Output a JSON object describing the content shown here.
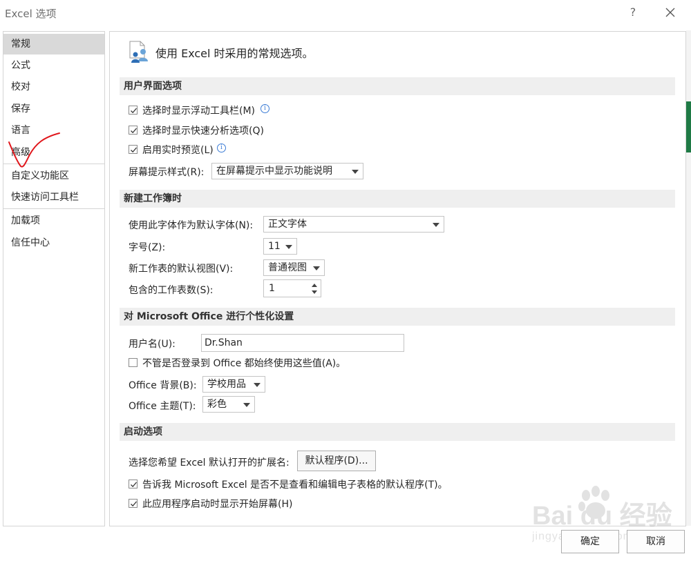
{
  "window": {
    "title": "Excel 选项",
    "help_label": "?"
  },
  "sidebar": {
    "items": [
      {
        "label": "常规",
        "active": true
      },
      {
        "label": "公式"
      },
      {
        "label": "校对"
      },
      {
        "label": "保存"
      },
      {
        "label": "语言"
      },
      {
        "label": "高级"
      },
      {
        "label": "自定义功能区"
      },
      {
        "label": "快速访问工具栏"
      },
      {
        "label": "加载项"
      },
      {
        "label": "信任中心"
      }
    ]
  },
  "main": {
    "header": "使用 Excel 时采用的常规选项。",
    "ui_options": {
      "title": "用户界面选项",
      "mini_toolbar": {
        "label": "选择时显示浮动工具栏(M)",
        "checked": true
      },
      "quick_analysis": {
        "label": "选择时显示快速分析选项(Q)",
        "checked": true
      },
      "live_preview": {
        "label": "启用实时预览(L)",
        "checked": true
      },
      "screentip_label": "屏幕提示样式(R):",
      "screentip_value": "在屏幕提示中显示功能说明"
    },
    "new_workbook": {
      "title": "新建工作簿时",
      "font_label": "使用此字体作为默认字体(N):",
      "font_value": "正文字体",
      "size_label": "字号(Z):",
      "size_value": "11",
      "view_label": "新工作表的默认视图(V):",
      "view_value": "普通视图",
      "sheets_label": "包含的工作表数(S):",
      "sheets_value": "1"
    },
    "personalize": {
      "title": "对 Microsoft Office 进行个性化设置",
      "username_label": "用户名(U):",
      "username_value": "Dr.Shan",
      "always_use": {
        "label": "不管是否登录到 Office 都始终使用这些值(A)。",
        "checked": false
      },
      "background_label": "Office 背景(B):",
      "background_value": "学校用品",
      "theme_label": "Office 主题(T):",
      "theme_value": "彩色"
    },
    "startup": {
      "title": "启动选项",
      "ext_label": "选择您希望 Excel 默认打开的扩展名:",
      "default_programs_button": "默认程序(D)...",
      "tell_me": {
        "label": "告诉我 Microsoft Excel 是否不是查看和编辑电子表格的默认程序(T)。",
        "checked": true
      },
      "show_start": {
        "label": "此应用程序启动时显示开始屏幕(H)",
        "checked": true
      }
    }
  },
  "footer": {
    "ok_label": "确定",
    "cancel_label": "取消"
  },
  "overlay": {
    "watermark_brand": "Bai du 经验",
    "watermark_url": "jingyan.baidu.com",
    "annotation_color": "#e0161b"
  },
  "colors": {
    "active_nav": "#d9d9d9",
    "section_header_bg": "#efefef",
    "info_icon": "#3a7bd5",
    "excel_green": "#1f7a45"
  }
}
